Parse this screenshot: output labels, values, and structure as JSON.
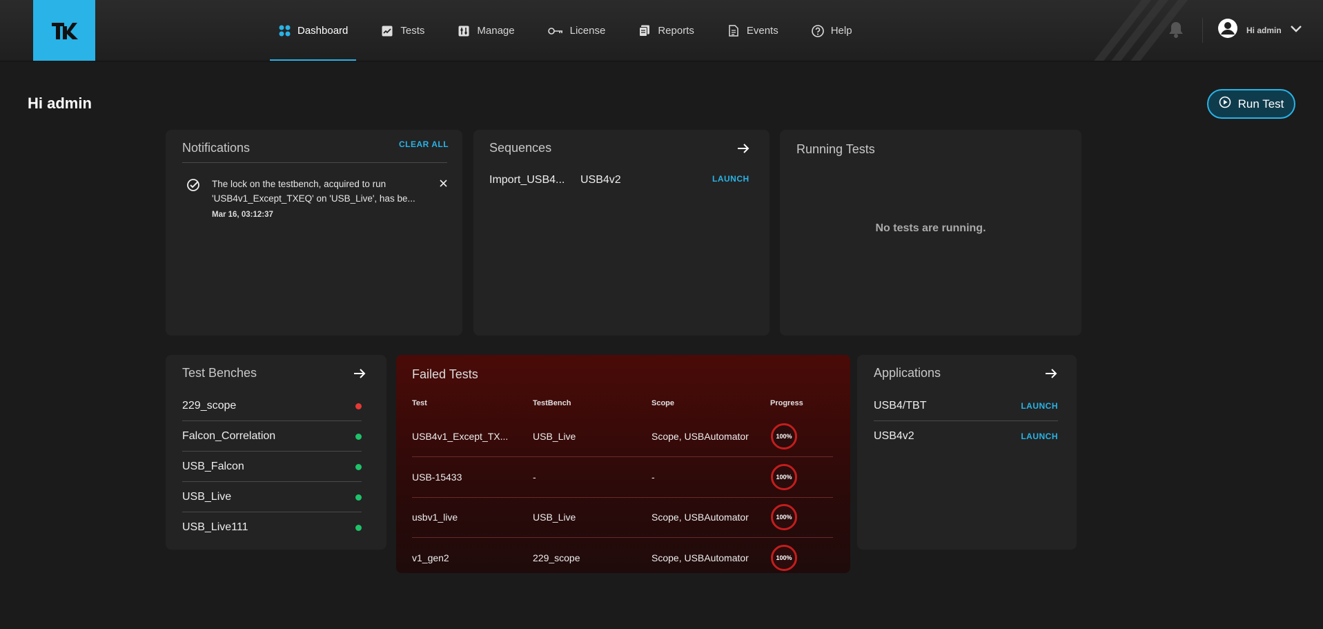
{
  "nav": {
    "items": [
      {
        "label": "Dashboard",
        "icon": "dashboard-grid-icon"
      },
      {
        "label": "Tests",
        "icon": "chart-icon"
      },
      {
        "label": "Manage",
        "icon": "sliders-icon"
      },
      {
        "label": "License",
        "icon": "key-icon"
      },
      {
        "label": "Reports",
        "icon": "reports-icon"
      },
      {
        "label": "Events",
        "icon": "document-icon"
      },
      {
        "label": "Help",
        "icon": "help-icon"
      }
    ],
    "active": "Dashboard",
    "user_label": "Hi admin"
  },
  "page": {
    "greeting": "Hi admin",
    "run_test_label": "Run Test"
  },
  "notifications": {
    "title": "Notifications",
    "clear_all": "CLEAR ALL",
    "items": [
      {
        "line1": "The lock on the testbench, acquired to run",
        "line2": "'USB4v1_Except_TXEQ' on 'USB_Live', has be...",
        "time": "Mar 16, 03:12:37"
      }
    ]
  },
  "sequences": {
    "title": "Sequences",
    "items": [
      {
        "name": "Import_USB4...",
        "app": "USB4v2",
        "action": "LAUNCH"
      }
    ]
  },
  "running_tests": {
    "title": "Running Tests",
    "empty_text": "No tests are running."
  },
  "test_benches": {
    "title": "Test Benches",
    "items": [
      {
        "name": "229_scope",
        "status_color": "#e53935"
      },
      {
        "name": "Falcon_Correlation",
        "status_color": "#1ec26a"
      },
      {
        "name": "USB_Falcon",
        "status_color": "#1ec26a"
      },
      {
        "name": "USB_Live",
        "status_color": "#1ec26a"
      },
      {
        "name": "USB_Live111",
        "status_color": "#1ec26a"
      }
    ]
  },
  "failed_tests": {
    "title": "Failed Tests",
    "columns": [
      "Test",
      "TestBench",
      "Scope",
      "Progress"
    ],
    "rows": [
      {
        "test": "USB4v1_Except_TX...",
        "bench": "USB_Live",
        "scope": "Scope, USBAutomator",
        "progress": "100%"
      },
      {
        "test": "USB-15433",
        "bench": "-",
        "scope": "-",
        "progress": "100%"
      },
      {
        "test": "usbv1_live",
        "bench": "USB_Live",
        "scope": "Scope, USBAutomator",
        "progress": "100%"
      },
      {
        "test": "v1_gen2",
        "bench": "229_scope",
        "scope": "Scope, USBAutomator",
        "progress": "100%"
      }
    ]
  },
  "applications": {
    "title": "Applications",
    "items": [
      {
        "name": "USB4/TBT",
        "action": "LAUNCH"
      },
      {
        "name": "USB4v2",
        "action": "LAUNCH"
      }
    ]
  },
  "colors": {
    "accent": "#29b3e6",
    "failed_bg": "#4a0b08",
    "error": "#c41d1d",
    "ok": "#1ec26a"
  }
}
